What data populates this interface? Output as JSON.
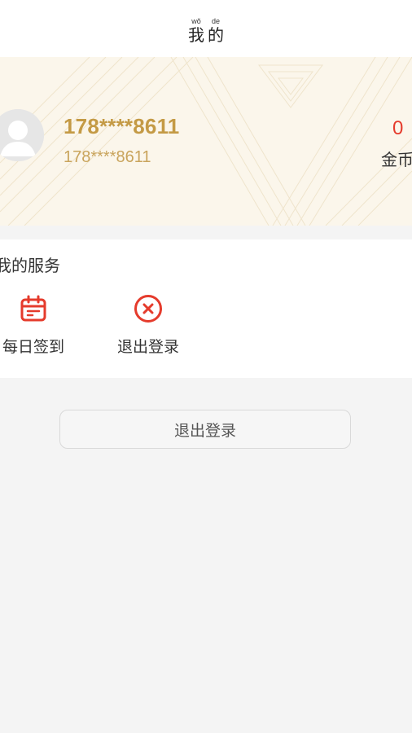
{
  "header": {
    "title_chars": [
      {
        "pinyin": "wǒ",
        "char": "我"
      },
      {
        "pinyin": "de",
        "char": "的"
      }
    ]
  },
  "profile": {
    "phone_main": "178****8611",
    "phone_sub": "178****8611",
    "coin_value": "0",
    "coin_label": "金币"
  },
  "services": {
    "title": "我的服务",
    "items": [
      {
        "label": "每日签到",
        "icon": "calendar-icon"
      },
      {
        "label": "退出登录",
        "icon": "close-circle-icon"
      }
    ]
  },
  "logout_button": {
    "label": "退出登录"
  },
  "colors": {
    "accent_red": "#e53b2c",
    "gold": "#c49a45",
    "banner_bg": "#fbf6eb"
  }
}
